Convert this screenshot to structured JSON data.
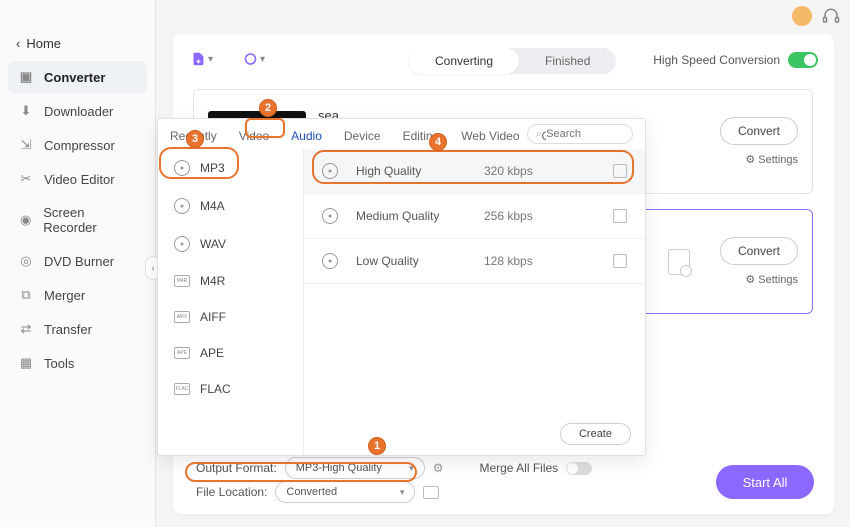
{
  "titlebar": {},
  "home": {
    "label": "Home"
  },
  "sidebar": {
    "items": [
      {
        "label": "Converter"
      },
      {
        "label": "Downloader"
      },
      {
        "label": "Compressor"
      },
      {
        "label": "Video Editor"
      },
      {
        "label": "Screen Recorder"
      },
      {
        "label": "DVD Burner"
      },
      {
        "label": "Merger"
      },
      {
        "label": "Transfer"
      },
      {
        "label": "Tools"
      }
    ]
  },
  "toolbar": {
    "converting": "Converting",
    "finished": "Finished",
    "hsc_label": "High Speed Conversion"
  },
  "files": {
    "0": {
      "title": "sea",
      "convert": "Convert",
      "settings": "Settings"
    },
    "1": {
      "convert": "Convert",
      "settings": "Settings"
    }
  },
  "popup": {
    "tabs": {
      "recently": "Recently",
      "video": "Video",
      "audio": "Audio",
      "device": "Device",
      "editing": "Editing",
      "webvideo": "Web Video",
      "custom": "Custom"
    },
    "search_placeholder": "Search",
    "formats": {
      "mp3": "MP3",
      "m4a": "M4A",
      "wav": "WAV",
      "m4r": "M4R",
      "aiff": "AIFF",
      "ape": "APE",
      "flac": "FLAC"
    },
    "qualities": {
      "0": {
        "name": "High Quality",
        "bitrate": "320 kbps"
      },
      "1": {
        "name": "Medium Quality",
        "bitrate": "256 kbps"
      },
      "2": {
        "name": "Low Quality",
        "bitrate": "128 kbps"
      }
    },
    "create": "Create"
  },
  "steps": {
    "1": "1",
    "2": "2",
    "3": "3",
    "4": "4"
  },
  "footer": {
    "output_label": "Output Format:",
    "output_value": "MP3-High Quality",
    "merge_label": "Merge All Files",
    "location_label": "File Location:",
    "location_value": "Converted",
    "start_all": "Start All"
  }
}
